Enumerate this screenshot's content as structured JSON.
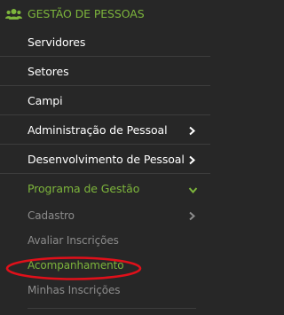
{
  "section": {
    "title": "GESTÃO DE PESSOAS",
    "icon": "users-icon",
    "color": "#7db53c"
  },
  "menu": {
    "items": [
      {
        "label": "Servidores"
      },
      {
        "label": "Setores"
      },
      {
        "label": "Campi"
      },
      {
        "label": "Administração de Pessoal",
        "icon": "chevron-right-icon"
      },
      {
        "label": "Desenvolvimento de Pessoal",
        "icon": "chevron-right-icon"
      },
      {
        "label": "Programa de Gestão",
        "icon": "chevron-down-icon",
        "expanded": true
      }
    ],
    "subitems": [
      {
        "label": "Cadastro",
        "icon": "chevron-right-icon"
      },
      {
        "label": "Avaliar Inscrições"
      },
      {
        "label": "Acompanhamento",
        "annotated": true
      },
      {
        "label": "Minhas Inscrições"
      }
    ]
  },
  "colors": {
    "background": "#272727",
    "accent": "#7db53c",
    "text": "#ffffff",
    "muted_text": "#8c8c8c",
    "annotation": "#e0101a"
  }
}
